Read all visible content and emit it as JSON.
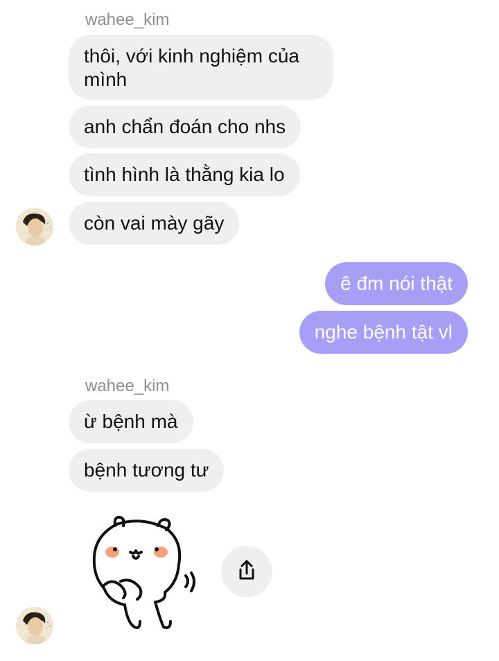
{
  "thread": {
    "group1": {
      "sender": "wahee_kim",
      "messages": [
        "thôi, với kinh nghiệm của mình",
        "anh chẩn đoán cho nhs",
        "tình hình là thằng kia lo",
        "còn vai mày gãy"
      ]
    },
    "outgoing": {
      "messages": [
        "ê đm nói thật",
        "nghe bệnh tật vl"
      ]
    },
    "group2": {
      "sender": "wahee_kim",
      "messages": [
        "ừ bệnh mà",
        "bệnh tương tư"
      ],
      "sticker": "white-bear-sticker"
    }
  },
  "colors": {
    "incoming_bubble": "#efefef",
    "outgoing_bubble": "#a79ef6",
    "sender_text": "#8e8e93"
  },
  "icons": {
    "share": "share-icon"
  }
}
